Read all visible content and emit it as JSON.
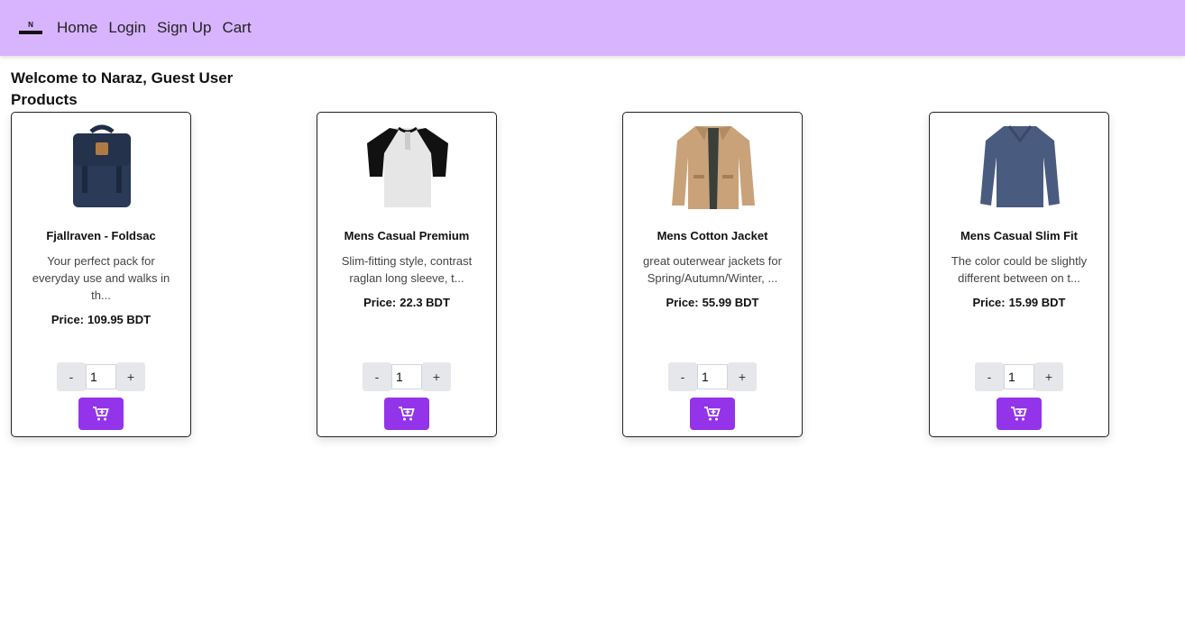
{
  "nav": {
    "logo_text": "N",
    "links": [
      "Home",
      "Login",
      "Sign Up",
      "Cart"
    ]
  },
  "welcome": "Welcome to Naraz, Guest User",
  "products_heading": "Products",
  "products": [
    {
      "title": "Fjallraven - Foldsac",
      "description": "Your perfect pack for everyday use and walks in th...",
      "price_label": "Price:",
      "price": "109.95 BDT",
      "quantity": "1",
      "image": "backpack"
    },
    {
      "title": "Mens Casual Premium",
      "description": "Slim-fitting style, contrast raglan long sleeve, t...",
      "price_label": "Price:",
      "price": "22.3 BDT",
      "quantity": "1",
      "image": "raglan-shirt"
    },
    {
      "title": "Mens Cotton Jacket",
      "description": "great outerwear jackets for Spring/Autumn/Winter, ...",
      "price_label": "Price:",
      "price": "55.99 BDT",
      "quantity": "1",
      "image": "jacket"
    },
    {
      "title": "Mens Casual Slim Fit",
      "description": "The color could be slightly different between on t...",
      "price_label": "Price:",
      "price": "15.99 BDT",
      "quantity": "1",
      "image": "long-sleeve-shirt"
    }
  ],
  "buttons": {
    "minus": "-",
    "plus": "+"
  },
  "colors": {
    "navbar": "#d8b4fe",
    "accent": "#9333ea"
  }
}
